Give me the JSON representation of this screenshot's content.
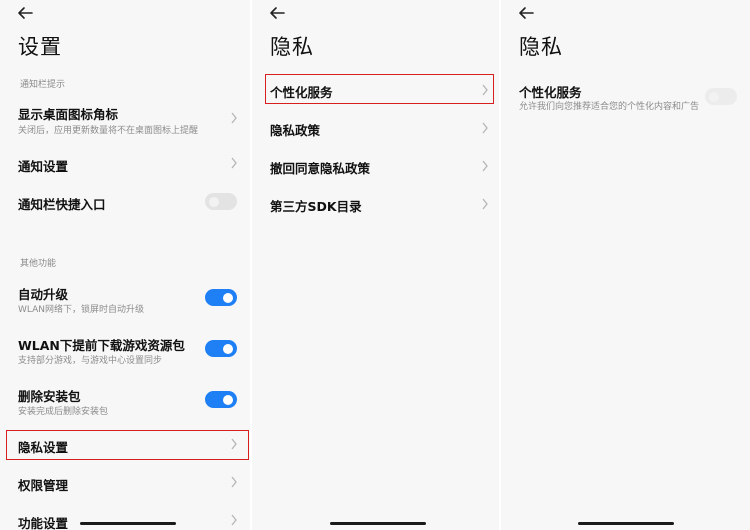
{
  "screen1": {
    "title": "设置",
    "section1": "通知栏提示",
    "items": [
      {
        "label": "显示桌面图标角标",
        "sub": "关闭后，应用更新数量将不在桌面图标上提醒"
      },
      {
        "label": "通知设置"
      },
      {
        "label": "通知栏快捷入口",
        "toggle": "off"
      }
    ],
    "section2": "其他功能",
    "items2": [
      {
        "label": "自动升级",
        "sub": "WLAN网络下，锁屏时自动升级",
        "toggle": "on"
      },
      {
        "label": "WLAN下提前下载游戏资源包",
        "sub": "支持部分游戏，与游戏中心设置同步",
        "toggle": "on"
      },
      {
        "label": "删除安装包",
        "sub": "安装完成后删除安装包",
        "toggle": "on"
      },
      {
        "label": "隐私设置"
      },
      {
        "label": "权限管理"
      },
      {
        "label": "功能设置"
      }
    ]
  },
  "screen2": {
    "title": "隐私",
    "items": [
      {
        "label": "个性化服务"
      },
      {
        "label": "隐私政策"
      },
      {
        "label": "撤回同意隐私政策"
      },
      {
        "label": "第三方SDK目录"
      }
    ]
  },
  "screen3": {
    "title": "隐私",
    "item": {
      "label": "个性化服务",
      "sub": "允许我们向您推荐适合您的个性化内容和广告",
      "toggle": "off"
    }
  },
  "colors": {
    "accent": "#1f7ff4",
    "highlight": "#d6201f"
  },
  "icons": [
    "back-arrow-icon",
    "chevron-right-icon"
  ]
}
